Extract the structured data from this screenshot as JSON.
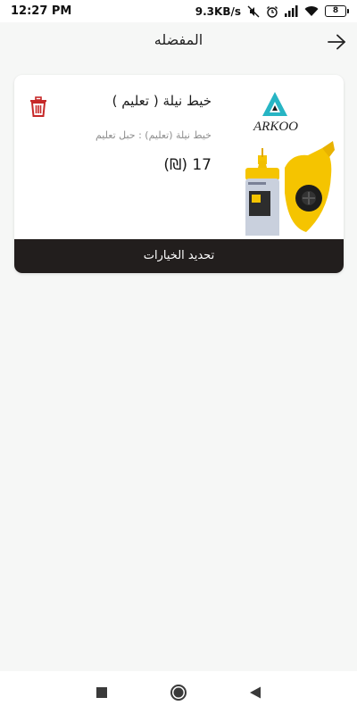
{
  "status_bar": {
    "time": "12:27 PM",
    "network_speed": "9.3KB/s",
    "battery_level": "8"
  },
  "header": {
    "title": "المفضله",
    "back_icon": "arrow-right-icon"
  },
  "favorites": [
    {
      "name": "خيط نيلة ( تعليم )",
      "variant": "خيط نيلة (تعليم) : حبل تعليم",
      "price": "17 (₪)",
      "brand_logo_text": "ARKOO",
      "delete_icon": "trash-icon",
      "update_button_label": "تحديد الخيارات"
    }
  ],
  "colors": {
    "delete_red": "#c62828",
    "button_dark": "#221e1d",
    "logo_teal": "#27b5c4",
    "product_yellow": "#f5c400"
  },
  "nav_bar": {
    "recents_icon": "square-icon",
    "home_icon": "circle-icon",
    "back_icon": "triangle-back-icon"
  }
}
